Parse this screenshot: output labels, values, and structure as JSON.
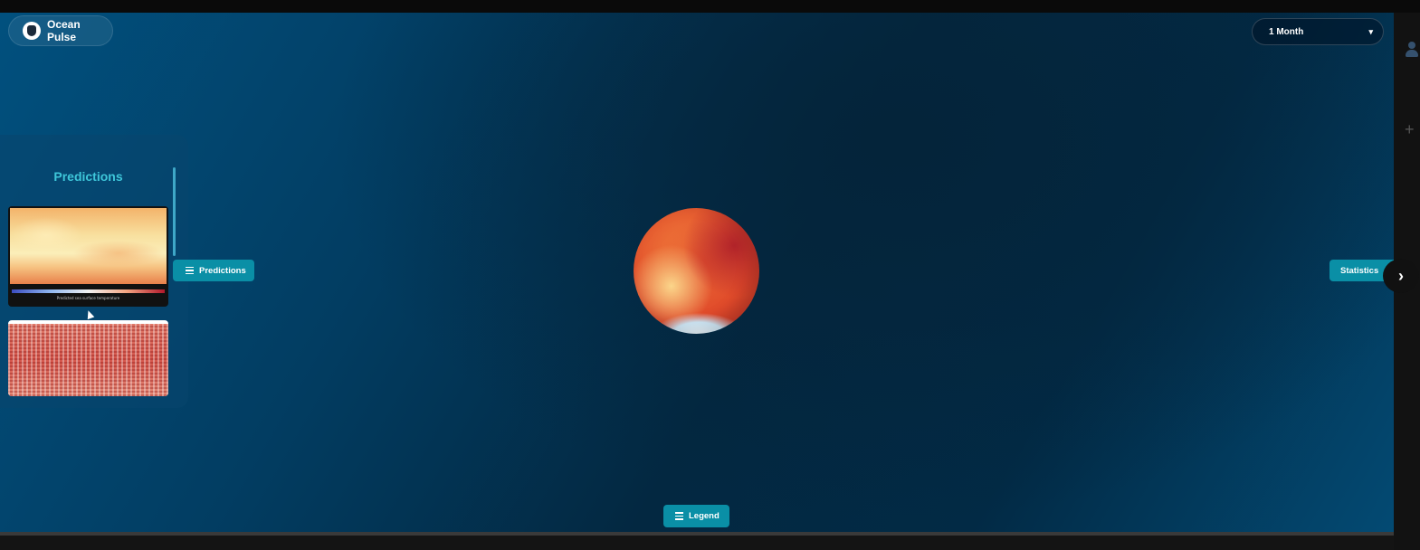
{
  "header": {
    "app_name": "Ocean Pulse",
    "logo_icon": "mug-icon"
  },
  "time_range": {
    "selected": "1 Month",
    "caret": "▾"
  },
  "predictions_panel": {
    "title": "Predictions",
    "thumbnails": [
      {
        "name": "temperature-prediction-map",
        "caption": "Predicted sea surface temperature"
      },
      {
        "name": "anomaly-grid-map"
      }
    ]
  },
  "buttons": {
    "predictions": "Predictions",
    "statistics": "Statistics",
    "legend": "Legend",
    "next_arrow": "›"
  },
  "colors": {
    "accent": "#0a8fa6",
    "title_teal": "#3ec6d9",
    "globe_hot": "#e04a2a",
    "globe_cold": "#cfe7f6"
  }
}
